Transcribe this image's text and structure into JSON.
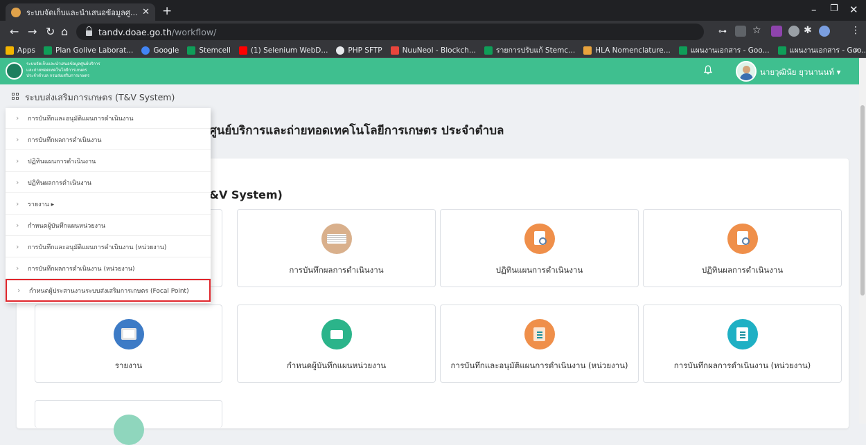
{
  "browser": {
    "tab_title": "ระบบจัดเก็บและนำเสนอข้อมูลศูนย์บริการ",
    "url_host": "tandv.doae.go.th",
    "url_path": "/workflow/",
    "bookmarks": [
      {
        "label": "Apps",
        "color": "#f4b400"
      },
      {
        "label": "Plan Golive Laborat...",
        "color": "#0f9d58"
      },
      {
        "label": "Google",
        "color": "#4285f4"
      },
      {
        "label": "Stemcell",
        "color": "#0f9d58"
      },
      {
        "label": "(1) Selenium WebD...",
        "color": "#ff0000"
      },
      {
        "label": "PHP SFTP",
        "color": "#e8eaed"
      },
      {
        "label": "NuuNeoI - Blockch...",
        "color": "#e8453c"
      },
      {
        "label": "รายการปรับแก้ Stemc...",
        "color": "#0f9d58"
      },
      {
        "label": "HLA Nomenclature...",
        "color": "#e8a33d"
      },
      {
        "label": "แผนงานเอกสาร - Goo...",
        "color": "#0f9d58"
      },
      {
        "label": "แผนงานเอกสาร - Goo...",
        "color": "#0f9d58"
      }
    ]
  },
  "header": {
    "logo_line1": "ระบบจัดเก็บและนำเสนอข้อมูลศูนย์บริการ",
    "logo_line2": "และถ่ายทอดเทคโนโลยีการเกษตร",
    "logo_line3": "ประจำตำบล กรมส่งเสริมการเกษตร",
    "user_name": "นายวุฒินัย ยุวนานนท์ ▾",
    "accent": "#3fbf8f"
  },
  "system": {
    "title": "ระบบส่งเสริมการเกษตร (T&V System)",
    "chevron": "⌄"
  },
  "page": {
    "title": "ศูนย์บริการและถ่ายทอดเทคโนโลยีการเกษตร ประจำตำบล",
    "panel_title": "&V System)"
  },
  "menu": {
    "items": [
      "การบันทึกและอนุมัติแผนการดำเนินงาน",
      "การบันทึกผลการดำเนินงาน",
      "ปฏิทินแผนการดำเนินงาน",
      "ปฏิทินผลการดำเนินงาน",
      "รายงาน ▸",
      "กำหนดผู้บันทึกแผนหน่วยงาน",
      "การบันทึกและอนุมัติแผนการดำเนินงาน (หน่วยงาน)",
      "การบันทึกผลการดำเนินงาน (หน่วยงาน)",
      "กำหนดผู้ประสานงานระบบส่งเสริมการเกษตร (Focal Point)"
    ],
    "highlighted_index": 8
  },
  "cards": [
    {
      "label": "การบันทึกผลการดำเนินงาน",
      "icon": "paper-stack-icon",
      "color": "#d9b08c"
    },
    {
      "label": "ปฏิทินแผนการดำเนินงาน",
      "icon": "document-search-icon",
      "color": "#ef8f4a"
    },
    {
      "label": "ปฏิทินผลการดำเนินงาน",
      "icon": "document-search-icon",
      "color": "#ef8f4a"
    },
    {
      "label": "รายงาน",
      "icon": "report-board-icon",
      "color": "#3d7bc6"
    },
    {
      "label": "กำหนดผู้บันทึกแผนหน่วยงาน",
      "icon": "folder-icon",
      "color": "#2bb48a"
    },
    {
      "label": "การบันทึกและอนุมัติแผนการดำเนินงาน (หน่วยงาน)",
      "icon": "sign-document-icon",
      "color": "#ef8f4a"
    },
    {
      "label": "การบันทึกผลการดำเนินงาน (หน่วยงาน)",
      "icon": "edit-note-icon",
      "color": "#1fb0c4"
    }
  ]
}
